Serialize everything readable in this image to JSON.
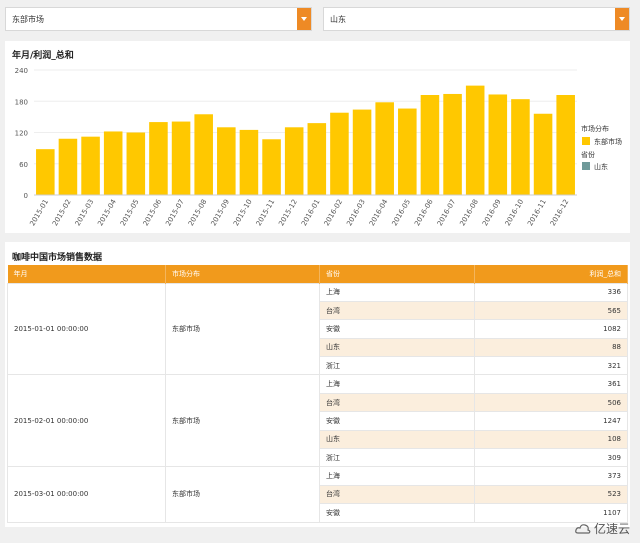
{
  "filters": {
    "market": "东部市场",
    "province": "山东"
  },
  "chart_panel": {
    "title": "年月/利润_总和"
  },
  "chart_data": {
    "type": "bar",
    "title": "年月/利润_总和",
    "categories": [
      "2015-01",
      "2015-02",
      "2015-03",
      "2015-04",
      "2015-05",
      "2015-06",
      "2015-07",
      "2015-08",
      "2015-09",
      "2015-10",
      "2015-11",
      "2015-12",
      "2016-01",
      "2016-02",
      "2016-03",
      "2016-04",
      "2016-05",
      "2016-06",
      "2016-07",
      "2016-08",
      "2016-09",
      "2016-10",
      "2016-11",
      "2016-12"
    ],
    "values": [
      88,
      108,
      112,
      122,
      120,
      140,
      141,
      155,
      130,
      125,
      107,
      130,
      138,
      158,
      164,
      178,
      166,
      192,
      194,
      210,
      193,
      184,
      156,
      192
    ],
    "ylim": [
      0,
      240
    ],
    "yticks": [
      0,
      60,
      120,
      180,
      240
    ],
    "color": "#ffc800",
    "legend": {
      "title1": "市场分布",
      "item1": "东部市场",
      "color1": "#ffc800",
      "title2": "省份",
      "item2": "山东",
      "color2": "#6f9a9a"
    }
  },
  "table_panel": {
    "title": "咖啡中国市场销售数据",
    "headers": [
      "年月",
      "市场分布",
      "省份",
      "利润_总和"
    ],
    "groups": [
      {
        "date": "2015-01-01 00:00:00",
        "market": "东部市场",
        "rows": [
          [
            "上海",
            "336"
          ],
          [
            "台湾",
            "565"
          ],
          [
            "安徽",
            "1082"
          ],
          [
            "山东",
            "88"
          ],
          [
            "浙江",
            "321"
          ]
        ]
      },
      {
        "date": "2015-02-01 00:00:00",
        "market": "东部市场",
        "rows": [
          [
            "上海",
            "361"
          ],
          [
            "台湾",
            "506"
          ],
          [
            "安徽",
            "1247"
          ],
          [
            "山东",
            "108"
          ],
          [
            "浙江",
            "309"
          ]
        ]
      },
      {
        "date": "2015-03-01 00:00:00",
        "market": "东部市场",
        "rows": [
          [
            "上海",
            "373"
          ],
          [
            "台湾",
            "523"
          ],
          [
            "安徽",
            "1107"
          ]
        ]
      }
    ]
  },
  "watermark": "亿速云"
}
